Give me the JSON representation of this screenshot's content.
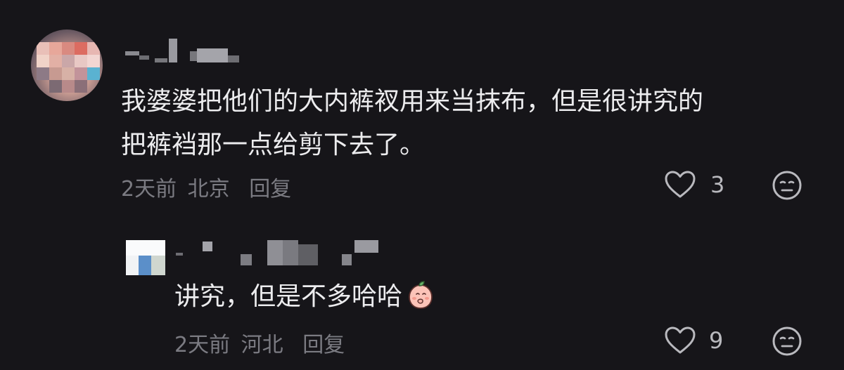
{
  "comments": [
    {
      "text_line1": "我婆婆把他们的大内裤衩用来当抹布，但是很讲究的",
      "text_line2": "把裤裆那一点给剪下去了。",
      "time": "2天前",
      "location": "北京",
      "reply_label": "回复",
      "likes": "3"
    }
  ],
  "replies": [
    {
      "text": "讲究，但是不多哈哈",
      "emoji": "peach-emoji",
      "time": "2天前",
      "location": "河北",
      "reply_label": "回复",
      "likes": "9"
    }
  ],
  "icons": {
    "like": "heart-outline-icon",
    "dislike": "meh-face-icon"
  },
  "colors": {
    "background": "#161519",
    "text": "#ececee",
    "meta": "#7b7b82",
    "icon": "#b9b9be"
  }
}
